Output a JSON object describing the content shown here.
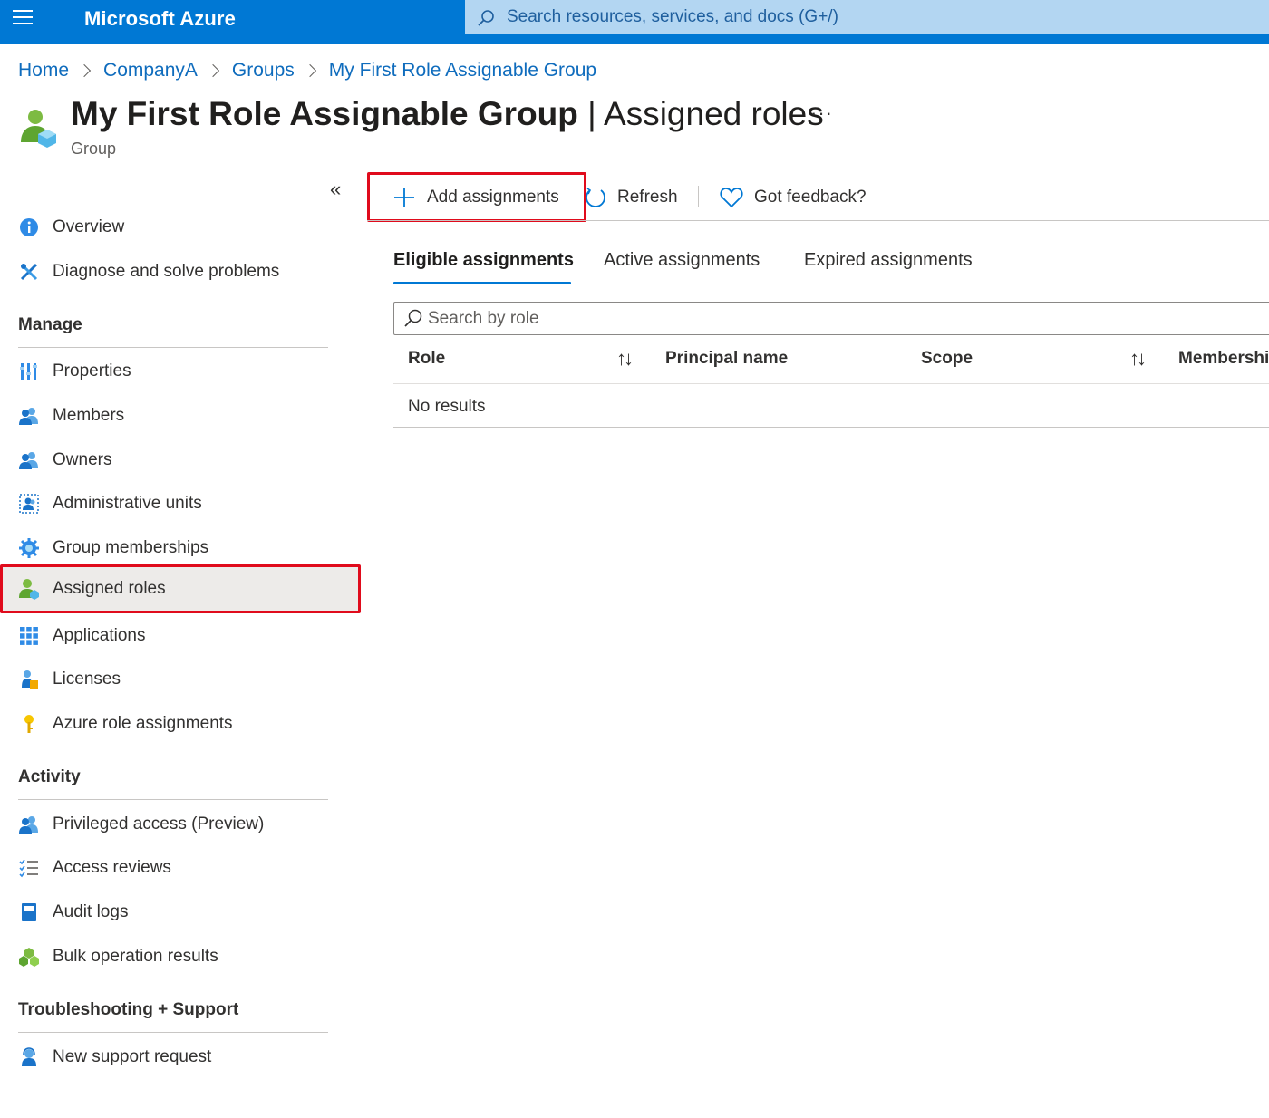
{
  "topbar": {
    "brand": "Microsoft Azure",
    "search_placeholder": "Search resources, services, and docs (G+/)"
  },
  "breadcrumb": [
    "Home",
    "CompanyA",
    "Groups",
    "My First Role Assignable Group"
  ],
  "header": {
    "title_name": "My First Role Assignable Group",
    "title_sep": " | ",
    "title_section": "Assigned roles",
    "subtitle": "Group",
    "more": "···"
  },
  "sidebar": {
    "collapse": "«",
    "top_items": [
      {
        "label": "Overview",
        "icon": "info-icon"
      },
      {
        "label": "Diagnose and solve problems",
        "icon": "tools-icon"
      }
    ],
    "sections": [
      {
        "title": "Manage",
        "items": [
          {
            "label": "Properties",
            "icon": "properties-icon"
          },
          {
            "label": "Members",
            "icon": "members-icon"
          },
          {
            "label": "Owners",
            "icon": "owners-icon"
          },
          {
            "label": "Administrative units",
            "icon": "admin-units-icon"
          },
          {
            "label": "Group memberships",
            "icon": "gear-icon"
          },
          {
            "label": "Assigned roles",
            "icon": "assigned-roles-icon",
            "selected": true
          },
          {
            "label": "Applications",
            "icon": "applications-grid-icon"
          },
          {
            "label": "Licenses",
            "icon": "licenses-icon"
          },
          {
            "label": "Azure role assignments",
            "icon": "key-icon"
          }
        ]
      },
      {
        "title": "Activity",
        "items": [
          {
            "label": "Privileged access (Preview)",
            "icon": "privileged-access-icon"
          },
          {
            "label": "Access reviews",
            "icon": "checklist-icon"
          },
          {
            "label": "Audit logs",
            "icon": "book-icon"
          },
          {
            "label": "Bulk operation results",
            "icon": "cubes-icon"
          }
        ]
      },
      {
        "title": "Troubleshooting + Support",
        "items": [
          {
            "label": "New support request",
            "icon": "support-person-icon"
          }
        ]
      }
    ]
  },
  "commands": {
    "add": "Add assignments",
    "refresh": "Refresh",
    "feedback": "Got feedback?"
  },
  "tabs": [
    {
      "label": "Eligible assignments",
      "active": true
    },
    {
      "label": "Active assignments",
      "active": false
    },
    {
      "label": "Expired assignments",
      "active": false
    }
  ],
  "search": {
    "placeholder": "Search by role"
  },
  "table": {
    "columns": [
      "Role",
      "Principal name",
      "Scope",
      "Membershi"
    ],
    "sort_glyph": "↑↓",
    "empty_text": "No results"
  },
  "colors": {
    "accent": "#0078d4",
    "highlight_border": "#e00b1c",
    "link": "#0f6cbd"
  }
}
